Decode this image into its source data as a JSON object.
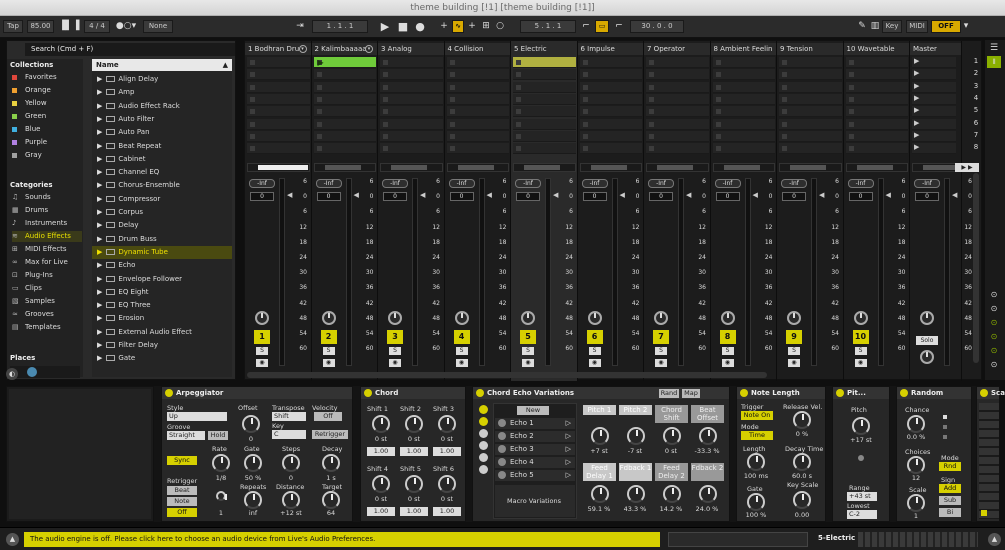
{
  "window": {
    "title": "theme building [!1]  [theme building [!1]]"
  },
  "toolbar": {
    "tap": "Tap",
    "tempo": "85.00",
    "meter": "4 / 4",
    "metro": "None",
    "pos1": "1 .  1 .  1",
    "pos2": "5 .  1 .  1",
    "pos3": "30 .  0 .  0",
    "key": "Key",
    "midi": "MIDI",
    "off": "OFF"
  },
  "browser": {
    "search": "Search (Cmd + F)",
    "collections_title": "Collections",
    "categories_title": "Categories",
    "places_title": "Places",
    "name_header": "Name",
    "collections": [
      {
        "label": "Favorites",
        "color": "#e0473c"
      },
      {
        "label": "Orange",
        "color": "#f0a030"
      },
      {
        "label": "Yellow",
        "color": "#e8d040"
      },
      {
        "label": "Green",
        "color": "#8ad04a"
      },
      {
        "label": "Blue",
        "color": "#40b0e0"
      },
      {
        "label": "Purple",
        "color": "#b080e0"
      },
      {
        "label": "Gray",
        "color": "#a0a0a0"
      }
    ],
    "categories": [
      "Sounds",
      "Drums",
      "Instruments",
      "Audio Effects",
      "MIDI Effects",
      "Max for Live",
      "Plug-Ins",
      "Clips",
      "Samples",
      "Grooves",
      "Templates"
    ],
    "items": [
      "Align Delay",
      "Amp",
      "Audio Effect Rack",
      "Auto Filter",
      "Auto Pan",
      "Beat Repeat",
      "Cabinet",
      "Channel EQ",
      "Chorus-Ensemble",
      "Compressor",
      "Corpus",
      "Delay",
      "Drum Buss",
      "Dynamic Tube",
      "Echo",
      "Envelope Follower",
      "EQ Eight",
      "EQ Three",
      "Erosion",
      "External Audio Effect",
      "Filter Delay",
      "Gate"
    ]
  },
  "tracks": [
    "1 Bodhran Dru",
    "2 Kalimbaaaaa",
    "3 Analog",
    "4 Collision",
    "5 Electric",
    "6 Impulse",
    "7 Operator",
    "8 Ambient Feelin",
    "9 Tension",
    "10 Wavetable",
    "Master"
  ],
  "scene_numbers": [
    "1",
    "2",
    "3",
    "4",
    "5",
    "6",
    "7",
    "8"
  ],
  "mixer": {
    "inf": "-Inf",
    "zero": "0",
    "scale": [
      "6",
      "0",
      "6",
      "12",
      "18",
      "24",
      "30",
      "36",
      "42",
      "48",
      "54",
      "60"
    ],
    "master_scale": [
      "6",
      "0",
      "6",
      "12",
      "18",
      "24",
      "30",
      "36",
      "42",
      "48",
      "54",
      "60"
    ],
    "solo": "Solo",
    "s": "S",
    "numbers": [
      "1",
      "2",
      "3",
      "4",
      "5",
      "6",
      "7",
      "8",
      "9",
      "10"
    ]
  },
  "arp": {
    "title": "Arpeggiator",
    "style": "Style",
    "style_v": "Up",
    "groove": "Groove",
    "groove_v": "Straight",
    "hold": "Hold",
    "offset": "Offset",
    "offset_v": "0",
    "transpose": "Transpose",
    "transpose_v": "Shift",
    "key": "Key",
    "key_v": "C",
    "velocity": "Velocity",
    "vel_v": "Off",
    "retrigger": "Retrigger",
    "sync": "Sync",
    "rate": "Rate",
    "rate_v": "1/8",
    "gate": "Gate",
    "gate_v": "50 %",
    "steps": "Steps",
    "steps_v": "0",
    "decay": "Decay",
    "decay_v": "1 s",
    "retrig": "Retrigger",
    "beat": "Beat",
    "note": "Note",
    "off": "Off",
    "repeats": "Repeats",
    "repeats_v": "inf",
    "one": "1",
    "distance": "Distance",
    "distance_v": "+12 st",
    "target": "Target",
    "target_v": "64"
  },
  "chord": {
    "title": "Chord",
    "shifts": [
      "Shift 1",
      "Shift 2",
      "Shift 3",
      "Shift 4",
      "Shift 5",
      "Shift 6"
    ],
    "st": "0 st",
    "v": "1.00"
  },
  "echo": {
    "title": "Chord Echo Variations",
    "rand": "Rand",
    "map": "Map",
    "new": "New",
    "items": [
      "Echo 1",
      "Echo 2",
      "Echo 3",
      "Echo 4",
      "Echo 5"
    ],
    "macro": "Macro Variations",
    "knobs": [
      {
        "n": "Pitch 1",
        "v": "+7 st"
      },
      {
        "n": "Pitch 2",
        "v": "-7 st"
      },
      {
        "n": "Chord Shift",
        "v": "0 st"
      },
      {
        "n": "Beat Offset",
        "v": "-33.3 %"
      },
      {
        "n": "Feed Delay 1",
        "v": "59.1 %"
      },
      {
        "n": "Fdback 1",
        "v": "43.3 %"
      },
      {
        "n": "Feed Delay 2",
        "v": "14.2 %"
      },
      {
        "n": "Fdback 2",
        "v": "24.0 %"
      }
    ]
  },
  "notelen": {
    "title": "Note Length",
    "trigger": "Trigger",
    "trigger_v": "Note On",
    "release": "Release Vel.",
    "release_v": "0 %",
    "mode": "Mode",
    "mode_v": "Time",
    "length": "Length",
    "length_v": "100 ms",
    "decay": "Decay Time",
    "decay_v": "60.0 s",
    "gate": "Gate",
    "gate_v": "100 %",
    "keyscale": "Key Scale",
    "keyscale_v": "0.00"
  },
  "pitch": {
    "title": "Pit...",
    "pitch": "Pitch",
    "pitch_v": "+17 st",
    "range": "Range",
    "range_v": "+43 st",
    "lowest": "Lowest",
    "lowest_v": "C-2"
  },
  "random": {
    "title": "Random",
    "chance": "Chance",
    "chance_v": "0.0 %",
    "choices": "Choices",
    "choices_v": "12",
    "scale": "Scale",
    "scale_v": "1",
    "mode": "Mode",
    "rnd": "Rnd",
    "sign": "Sign",
    "add": "Add",
    "sub": "Sub",
    "bi": "Bi"
  },
  "scal": {
    "title": "Scal"
  },
  "status": {
    "text": "The audio engine is off. Please click here to choose an audio device from Live's Audio Preferences.",
    "track": "5-Electric"
  }
}
